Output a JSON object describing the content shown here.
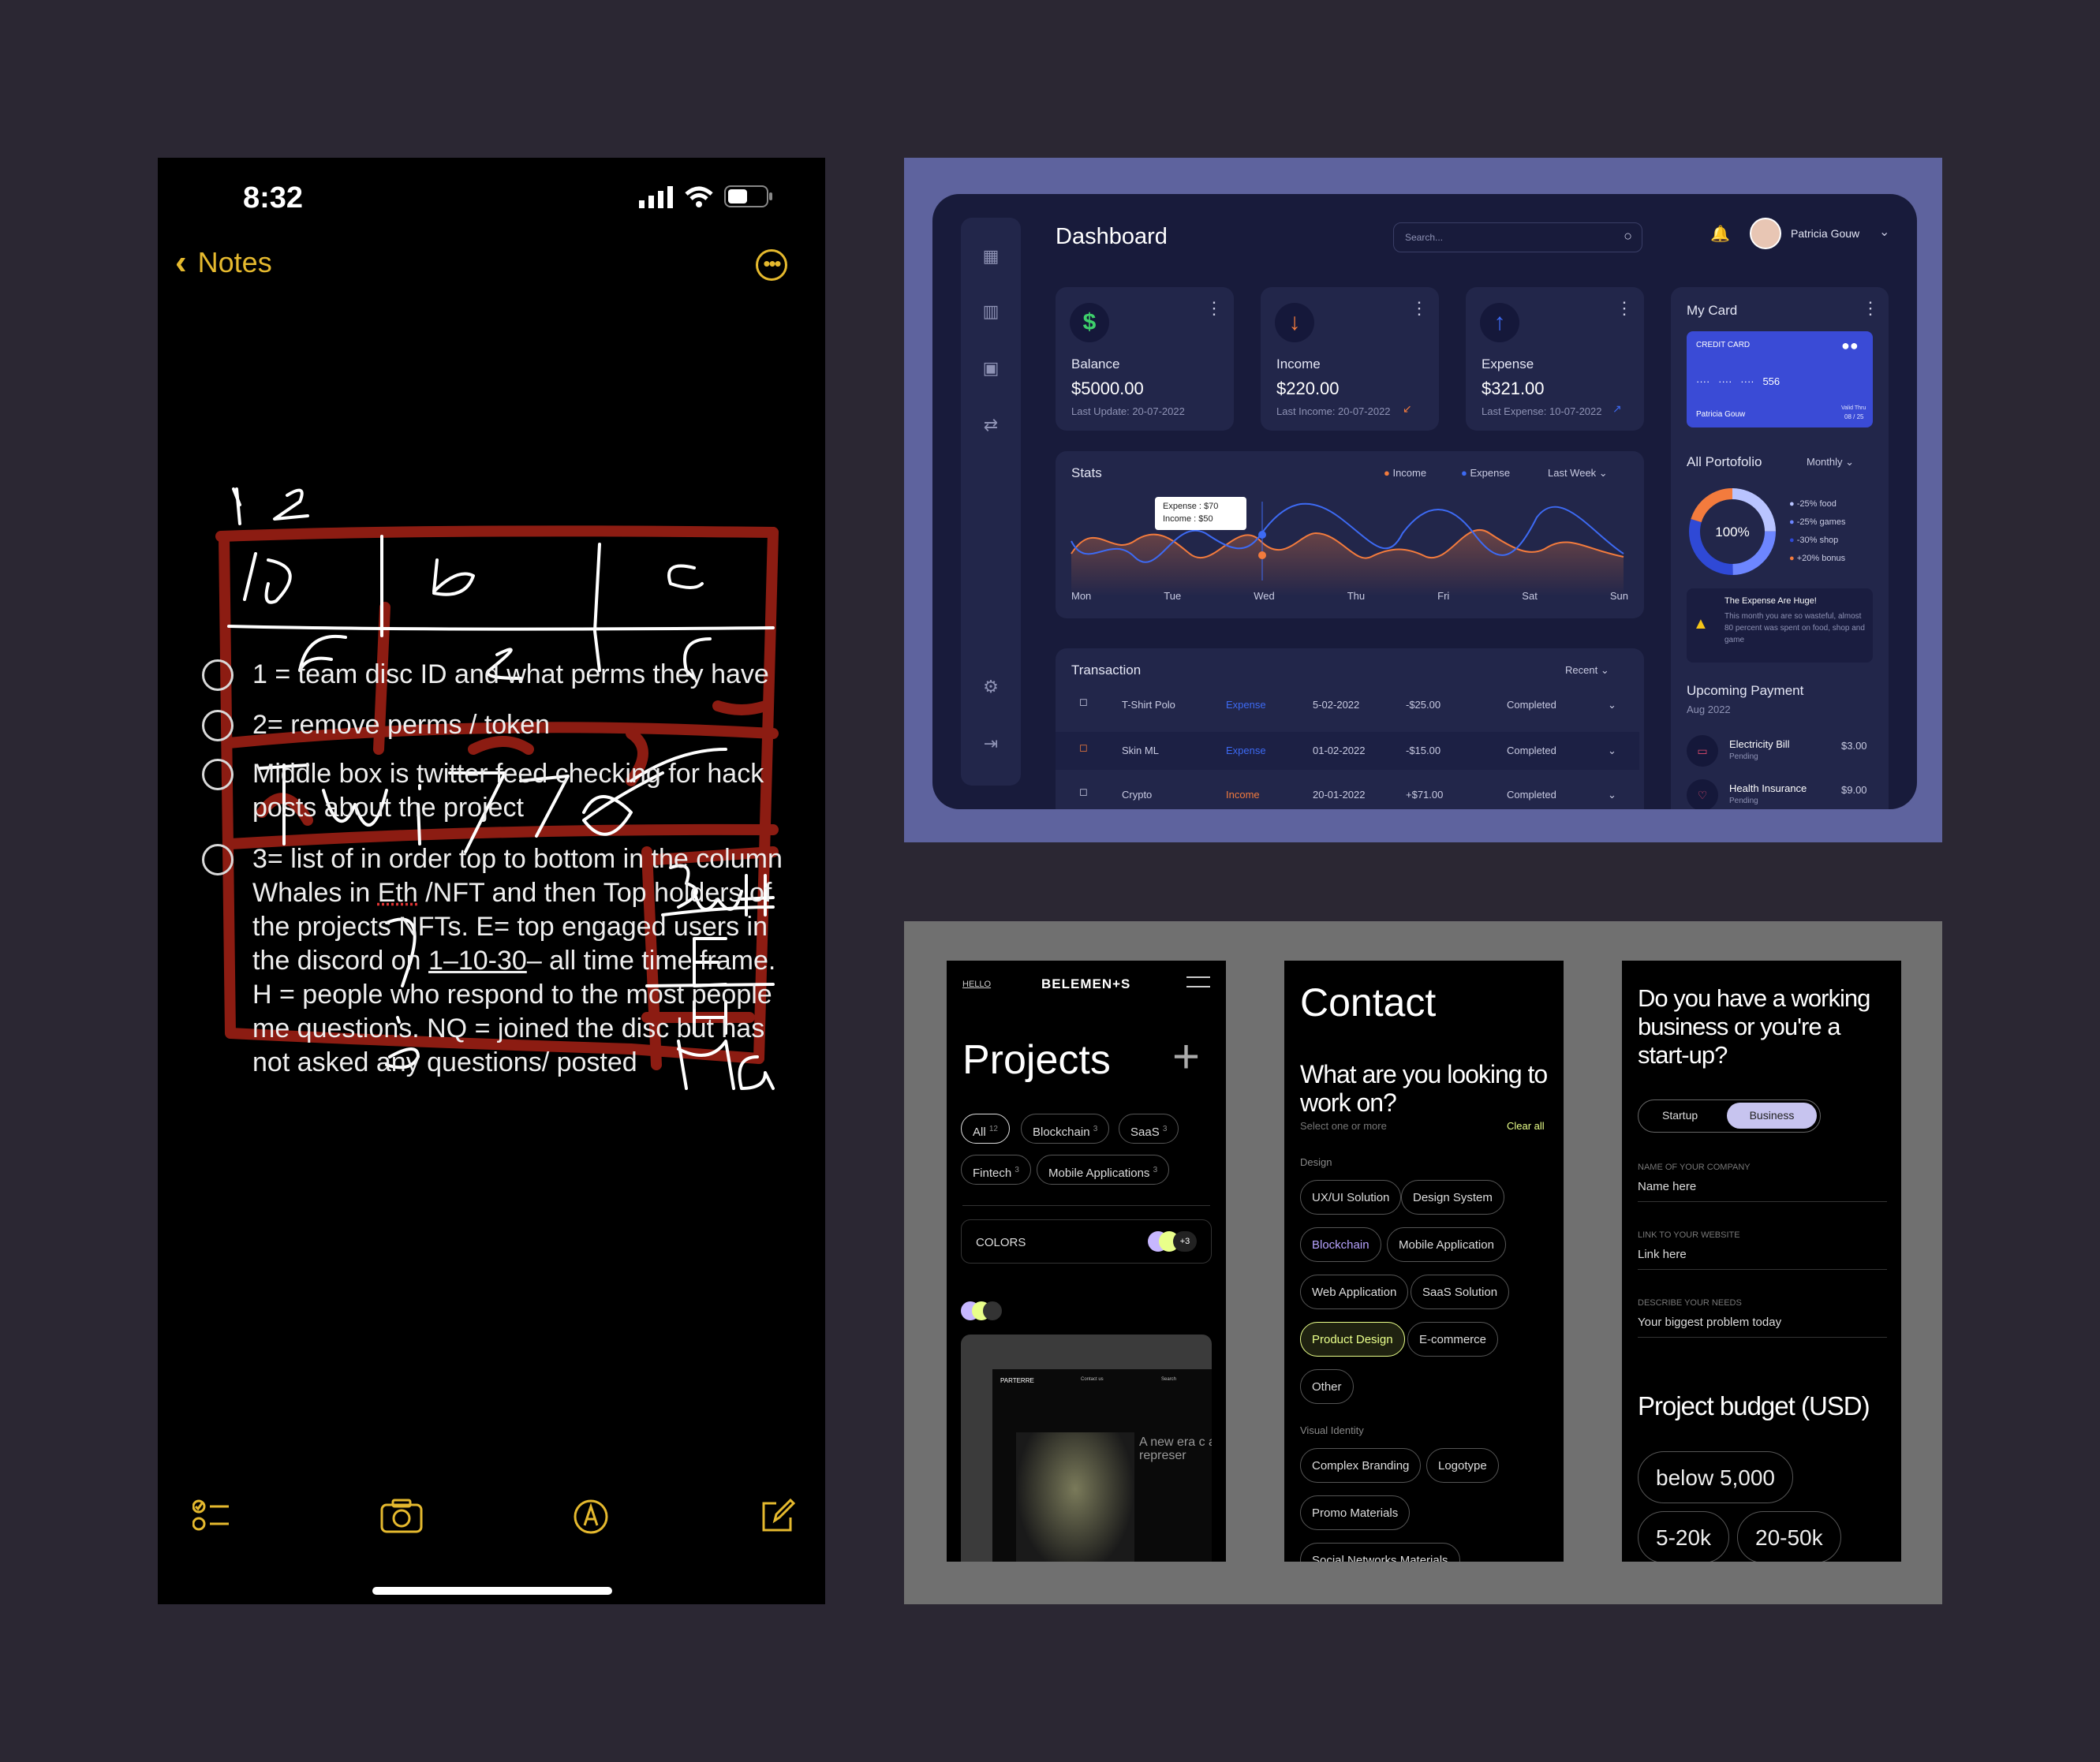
{
  "phone": {
    "time": "8:32",
    "back_label": "Notes",
    "sketch_marks": [
      "1",
      "2",
      "1D",
      "b",
      "c",
      "d",
      "E",
      "F",
      "Twitter",
      "?",
      "3 WH",
      "E",
      "H",
      "NQ"
    ],
    "todos": [
      {
        "text": "1 = team disc ID and what perms they have"
      },
      {
        "text": "2= remove perms / token"
      },
      {
        "text": "Middle box is twitter feed checking for hack posts about the project"
      }
    ],
    "todo4": {
      "part1": "3= list of in order top to bottom in the column Whales in ",
      "eth": "Eth",
      "part2": " /NFT and then Top holders of the projects NFTs. E= top engaged users in the discord on ",
      "range": "1–10-30",
      "part3": "– all time time frame. H = people who respond to the most people me questions. NQ = joined the disc but has not asked any questions/ posted"
    },
    "toolbar": [
      "checklist-icon",
      "camera-icon",
      "markup-icon",
      "compose-icon"
    ]
  },
  "dashboard": {
    "title": "Dashboard",
    "search_placeholder": "Search...",
    "user_name": "Patricia Gouw",
    "sidebar": [
      "grid-icon",
      "chart-icon",
      "wallet-icon",
      "transfer-icon",
      "settings-icon",
      "logout-icon"
    ],
    "stats_cards": [
      {
        "label": "Balance",
        "amount": "$5000.00",
        "note": "Last Update: 20-07-2022",
        "icon": "$",
        "color": "#3ecf6b"
      },
      {
        "label": "Income",
        "amount": "$220.00",
        "note": "Last Income: 20-07-2022",
        "icon": "↓",
        "color": "#f37b3d"
      },
      {
        "label": "Expense",
        "amount": "$321.00",
        "note": "Last Expense: 10-07-2022",
        "icon": "↑",
        "color": "#3d6af3"
      }
    ],
    "stats": {
      "title": "Stats",
      "legend_income": "Income",
      "legend_expense": "Expense",
      "period": "Last Week",
      "days": [
        "Mon",
        "Tue",
        "Wed",
        "Thu",
        "Fri",
        "Sat",
        "Sun"
      ],
      "tooltip_expense": "Expense : $70",
      "tooltip_income": "Income    : $50"
    },
    "transaction": {
      "title": "Transaction",
      "filter": "Recent",
      "rows": [
        {
          "name": "T-Shirt Polo",
          "type": "Expense",
          "date": "5-02-2022",
          "amount": "-$25.00",
          "status": "Completed"
        },
        {
          "name": "Skin ML",
          "type": "Expense",
          "date": "01-02-2022",
          "amount": "-$15.00",
          "status": "Completed"
        },
        {
          "name": "Crypto",
          "type": "Income",
          "date": "20-01-2022",
          "amount": "+$71.00",
          "status": "Completed"
        }
      ]
    },
    "my_card": {
      "title": "My Card",
      "card_label": "CREDIT CARD",
      "number": "····   ····   ····   556",
      "holder": "Patricia Gouw",
      "valid_label": "Valid Thru",
      "valid": "08 / 25"
    },
    "portfolio": {
      "title": "All Portofolio",
      "period": "Monthly",
      "center": "100%",
      "items": [
        {
          "label": "-25% food",
          "color": "#b9c4ff"
        },
        {
          "label": "-25% games",
          "color": "#6d86ff"
        },
        {
          "label": "-30% shop",
          "color": "#2f49d6"
        },
        {
          "label": "+20% bonus",
          "color": "#f37b3d"
        }
      ]
    },
    "alert": {
      "title": "The Expense Are Huge!",
      "text": "This month you are so wasteful, almost 80 percent was spent on food, shop and game"
    },
    "upcoming": {
      "title": "Upcoming Payment",
      "month": "Aug 2022",
      "items": [
        {
          "name": "Electricity Bill",
          "status": "Pending",
          "amount": "$3.00"
        },
        {
          "name": "Health Insurance",
          "status": "Pending",
          "amount": "$9.00"
        }
      ]
    }
  },
  "screen1": {
    "hello": "HELLO",
    "brand": "BELEMEN+S",
    "title": "Projects",
    "chips": [
      {
        "label": "All",
        "count": "12"
      },
      {
        "label": "Blockchain",
        "count": "3"
      },
      {
        "label": "SaaS",
        "count": "3"
      },
      {
        "label": "Fintech",
        "count": "3"
      },
      {
        "label": "Mobile Applications",
        "count": "3"
      }
    ],
    "colors_label": "COLORS",
    "colors_more": "+3",
    "preview_brand": "PARTERRE",
    "preview_nav1": "Contact us",
    "preview_nav2": "Search",
    "preview_text": "A new era c art represer"
  },
  "screen2": {
    "title": "Contact",
    "question": "What are you looking to work on?",
    "hint": "Select one or more",
    "clear": "Clear all",
    "design_label": "Design",
    "design_chips": [
      "UX/UI Solution",
      "Design System",
      "Blockchain",
      "Mobile Application",
      "Web Application",
      "SaaS Solution",
      "Product Design",
      "E-commerce",
      "Other"
    ],
    "visual_label": "Visual Identity",
    "visual_chips": [
      "Complex Branding",
      "Logotype",
      "Promo Materials",
      "Social Networks Materials"
    ]
  },
  "screen3": {
    "question": "Do you have a working business or you're a start-up?",
    "toggle_a": "Startup",
    "toggle_b": "Business",
    "fields": [
      {
        "label": "NAME OF YOUR COMPANY",
        "value": "Name here"
      },
      {
        "label": "LINK TO YOUR WEBSITE",
        "value": "Link here"
      },
      {
        "label": "DESCRIBE YOUR NEEDS",
        "value": "Your biggest problem today"
      }
    ],
    "budget_title": "Project budget (USD)",
    "budget_chips": [
      "below 5,000",
      "5-20k",
      "20-50k"
    ]
  }
}
